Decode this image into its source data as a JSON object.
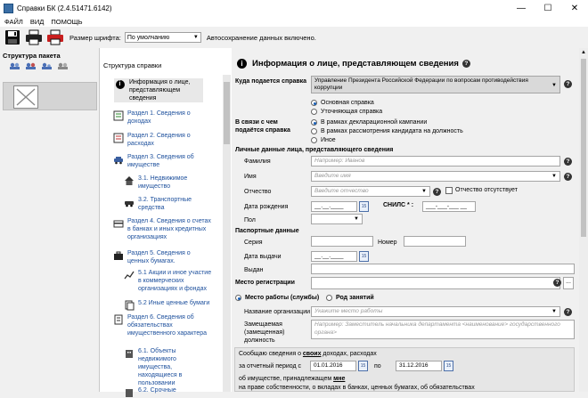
{
  "window": {
    "title": "Справки БК (2.4.51471.6142)",
    "minimize": "—",
    "maximize": "☐",
    "close": "✕"
  },
  "menu": [
    "ФАЙЛ",
    "ВИД",
    "ПОМОЩЬ"
  ],
  "toolbar": {
    "font_size_label": "Размер шрифта:",
    "font_size_value": "По умолчанию",
    "autosave_text": "Автосохранение данных включено."
  },
  "left_panel": {
    "title": "Структура пакета"
  },
  "tree": {
    "title": "Структура справки",
    "items": [
      {
        "label": "Информация о лице, представляющем сведения",
        "icon": "info-icon"
      },
      {
        "label": "Раздел 1. Сведения о доходах",
        "icon": "income-icon"
      },
      {
        "label": "Раздел 2. Сведения о расходах",
        "icon": "expense-icon"
      },
      {
        "label": "Раздел 3. Сведения об имуществе",
        "icon": "car-icon"
      },
      {
        "label": "3.1. Недвижимое имущество",
        "icon": "house-icon"
      },
      {
        "label": "3.2. Транспортные средства",
        "icon": "vehicle-icon"
      },
      {
        "label": "Раздел 4. Сведения о счетах в банках и иных кредитных организациях",
        "icon": "bank-icon"
      },
      {
        "label": "Раздел 5. Сведения о ценных бумагах.",
        "icon": "briefcase-icon"
      },
      {
        "label": "5.1 Акции и иное участие в коммерческих организациях и фондах",
        "icon": "chart-icon"
      },
      {
        "label": "5.2 Иные ценные бумаги",
        "icon": "papers-icon"
      },
      {
        "label": "Раздел 6. Сведения об обязательствах имущественного характера",
        "icon": "obligation-icon"
      },
      {
        "label": "6.1. Объекты недвижимого имущества, находящиеся в пользовании",
        "icon": "realty-icon"
      },
      {
        "label": "6.2. Срочные",
        "icon": "urgent-icon"
      }
    ]
  },
  "form": {
    "header": "Информация о лице, представляющем сведения",
    "where_label": "Куда подается справка",
    "where_value": "Управление Президента Российской Федерации по вопросам противодействия коррупции",
    "type_options": [
      "Основная справка",
      "Уточняющая справка"
    ],
    "reason_label": "В связи с чем подаётся справка",
    "reason_options": [
      "В рамках декларационной кампании",
      "В рамках рассмотрения кандидата на должность",
      "Иное"
    ],
    "personal_section": "Личные данные лица, представляющего сведения",
    "surname_label": "Фамилия",
    "surname_placeholder": "Например: Иванов",
    "name_label": "Имя",
    "name_placeholder": "Введите имя",
    "patronymic_label": "Отчество",
    "patronymic_placeholder": "Введите отчество",
    "no_patronymic": "Отчество отсутствует",
    "birth_label": "Дата рождения",
    "date_mask": "__.__.____",
    "snils_label": "СНИЛС * :",
    "snils_mask": "___-___-___ __",
    "sex_label": "Пол",
    "passport_section": "Паспортные данные",
    "series_label": "Серия",
    "number_label": "Номер",
    "issue_date_label": "Дата выдачи",
    "issued_by_label": "Выдан",
    "registration_label": "Место регистрации",
    "work_option": "Место работы (службы)",
    "occupation_option": "Род занятий",
    "org_label": "Название организации",
    "org_placeholder": "Укажите место работы",
    "position_label": "Замещаемая (замещенная) должность",
    "position_placeholder": "Например: Заместитель начальника департамента <наименование> государственного органа>",
    "report_pre": "Сообщаю сведения о ",
    "report_own": "своих",
    "report_post": " доходах, расходах",
    "period_label": "за отчетный период с",
    "period_from": "01.01.2016",
    "period_to_label": "по",
    "period_to": "31.12.2016",
    "property_pre": "об имуществе, принадлежащем ",
    "property_me": "мне",
    "property_line2": "на праве собственности, о вкладах в банках, ценных бумагах, об обязательствах"
  },
  "colors": {
    "link": "#1c4f9c",
    "accent": "#1a5fb4"
  }
}
